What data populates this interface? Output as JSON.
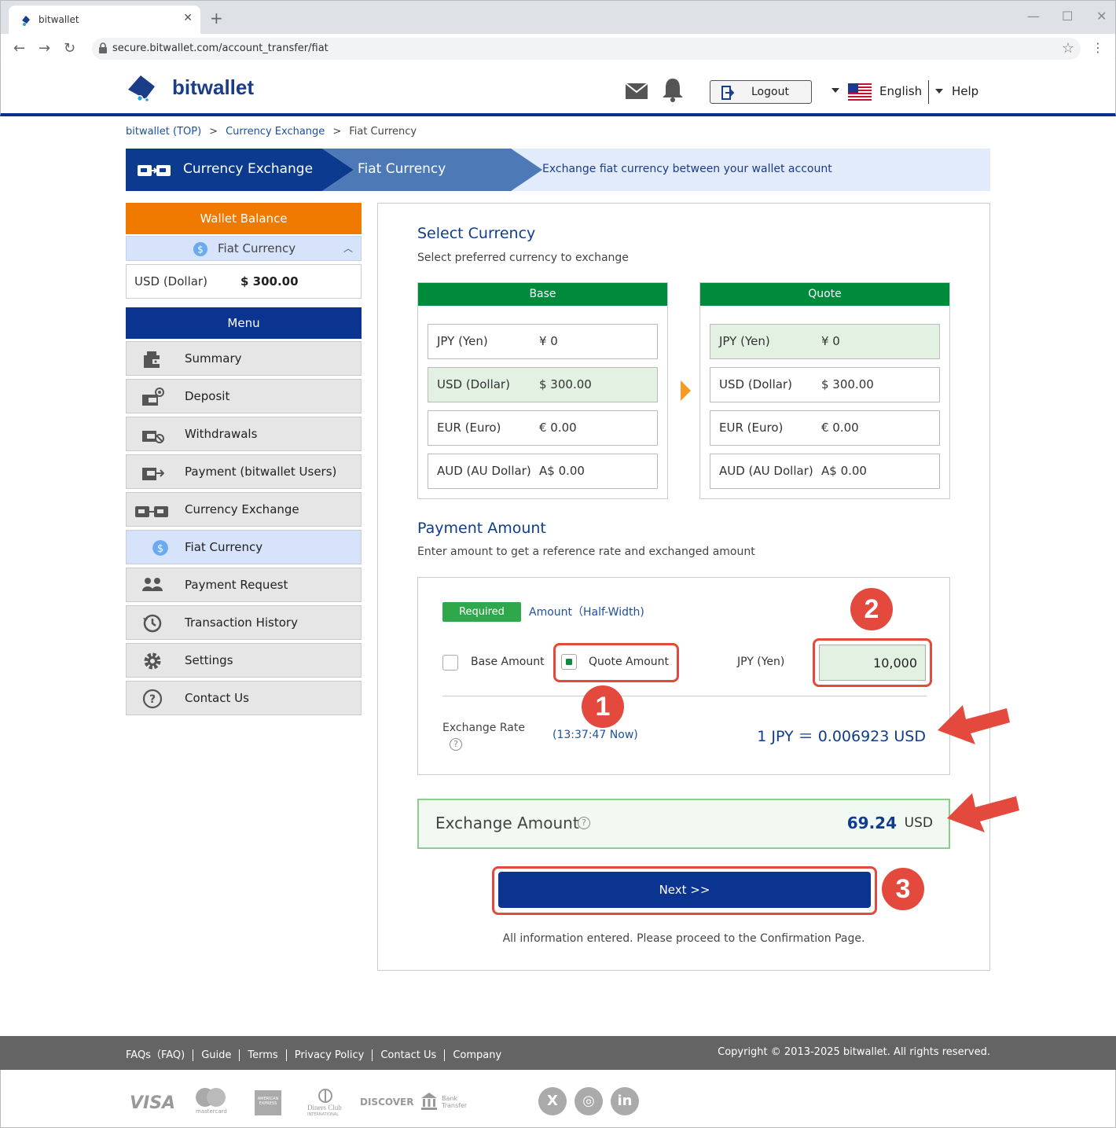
{
  "browser": {
    "tab_title": "bitwallet",
    "tab_close": "✕",
    "new_tab": "+",
    "url": "secure.bitwallet.com/account_transfer/fiat",
    "back": "←",
    "forward": "→",
    "reload": "↻",
    "bookmark": "☆",
    "menu": "⋮",
    "minimize": "—",
    "maximize": "☐",
    "close": "✕"
  },
  "header": {
    "logo_text": "bitwallet",
    "logout_label": "Logout",
    "language": "English",
    "help": "Help"
  },
  "breadcrumb": {
    "top": "bitwallet (TOP)",
    "sep": ">",
    "exchange": "Currency Exchange",
    "current": "Fiat Currency"
  },
  "banner": {
    "step1": "Currency Exchange",
    "step2": "Fiat Currency",
    "description": "Exchange fiat currency between your wallet account"
  },
  "sidebar": {
    "wallet_balance_title": "Wallet Balance",
    "wallet_sub": "Fiat Currency",
    "wallet_sub_chevron": "︿",
    "balance_currency": "USD (Dollar)",
    "balance_value": "$ 300.00",
    "menu_title": "Menu",
    "items": [
      {
        "label": "Summary",
        "icon": "wallet-icon"
      },
      {
        "label": "Deposit",
        "icon": "deposit-icon"
      },
      {
        "label": "Withdrawals",
        "icon": "withdrawal-icon"
      },
      {
        "label": "Payment (bitwallet Users)",
        "icon": "payment-icon"
      },
      {
        "label": "Currency Exchange",
        "icon": "exchange-icon"
      },
      {
        "label": "Fiat Currency",
        "icon": "dollar-coin-icon",
        "active": true
      },
      {
        "label": "Payment Request",
        "icon": "users-icon"
      },
      {
        "label": "Transaction History",
        "icon": "history-icon"
      },
      {
        "label": "Settings",
        "icon": "gear-icon"
      },
      {
        "label": "Contact Us",
        "icon": "question-icon"
      }
    ]
  },
  "select_currency": {
    "title": "Select Currency",
    "subtitle": "Select preferred currency to exchange",
    "base_header": "Base",
    "quote_header": "Quote",
    "base_rows": [
      {
        "name": "JPY (Yen)",
        "value": "¥ 0"
      },
      {
        "name": "USD (Dollar)",
        "value": "$ 300.00"
      },
      {
        "name": "EUR (Euro)",
        "value": "€ 0.00"
      },
      {
        "name": "AUD (AU Dollar)",
        "value": "A$ 0.00"
      }
    ],
    "quote_rows": [
      {
        "name": "JPY (Yen)",
        "value": "¥ 0"
      },
      {
        "name": "USD (Dollar)",
        "value": "$ 300.00"
      },
      {
        "name": "EUR (Euro)",
        "value": "€ 0.00"
      },
      {
        "name": "AUD (AU Dollar)",
        "value": "A$ 0.00"
      }
    ]
  },
  "payment_amount": {
    "title": "Payment Amount",
    "subtitle": "Enter amount to get a reference rate and exchanged amount",
    "required_badge": "Required",
    "amount_label": "Amount（Half-Width)",
    "base_amount_label": "Base Amount",
    "quote_amount_label": "Quote Amount",
    "currency_label": "JPY (Yen)",
    "amount_value": "10,000",
    "rate_label": "Exchange Rate",
    "rate_help": "?",
    "rate_time": "(13:37:47 Now)",
    "rate_value": "1 JPY ＝ 0.006923 USD"
  },
  "exchange": {
    "label": "Exchange Amount",
    "help": "?",
    "value": "69.24",
    "unit": "USD"
  },
  "next_button": "Next >>",
  "info_message": "All information entered. Please proceed to the Confirmation Page.",
  "steps": [
    "1",
    "2",
    "3"
  ],
  "footer": {
    "links": [
      "FAQs（FAQ)",
      "Guide",
      "Terms",
      "Privacy Policy",
      "Contact Us",
      "Company"
    ],
    "copyright": "Copyright © 2013-2025 bitwallet. All rights reserved."
  },
  "payment_methods": {
    "visa": "VISA",
    "mastercard": "mastercard",
    "amex": "AMERICAN EXPRESS",
    "diners": "Diners Club",
    "diners_sub": "INTERNATIONAL",
    "discover": "DISCOVER",
    "bank": "Bank",
    "bank_sub": "Transfer"
  },
  "social": {
    "x": "X",
    "instagram": "◎",
    "linkedin": "in"
  },
  "colors": {
    "brand_navy": "#0a3490",
    "orange": "#f07a00",
    "green": "#008a3c",
    "annotation_red": "#e4493d"
  }
}
